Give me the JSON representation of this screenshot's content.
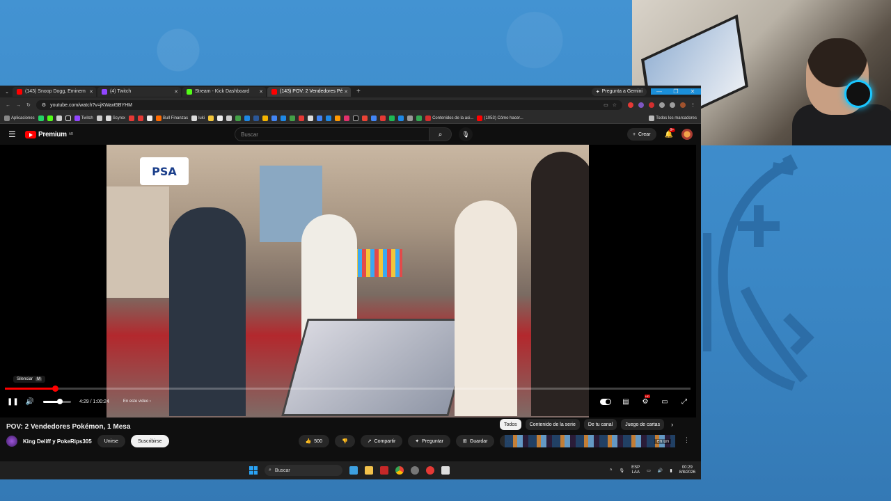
{
  "browser": {
    "tabs": [
      {
        "label": "(143) Snoop Dogg, Eminem",
        "favicon_color": "#ff0000",
        "active": false
      },
      {
        "label": "(4) Twitch",
        "favicon_color": "#9146ff",
        "active": false
      },
      {
        "label": "Stream - Kick Dashboard",
        "favicon_color": "#53fc18",
        "active": false
      },
      {
        "label": "(143) POV: 2 Vendedores Pé",
        "favicon_color": "#ff0000",
        "active": true
      }
    ],
    "new_tab_label": "+",
    "gemini_label": "Pregunta a Gemini",
    "url": "youtube.com/watch?v=jKWaxt5BYHM",
    "bookmarks": [
      {
        "label": "Aplicaciones",
        "color": "#888888"
      },
      {
        "label": "",
        "color": "#25d366"
      },
      {
        "label": "",
        "color": "#53fc18"
      },
      {
        "label": "Twitch",
        "color": "#9146ff"
      },
      {
        "label": "Scyrox",
        "color": "#d0d0d0"
      },
      {
        "label": "Bull Finanzas",
        "color": "#ff6a00"
      },
      {
        "label": "luki",
        "color": "#d0d0d0"
      },
      {
        "label": "",
        "color": "#e33b2e"
      },
      {
        "label": "",
        "color": "#1e88e5"
      },
      {
        "label": "",
        "color": "#43a047"
      },
      {
        "label": "Contenidos de la asi...",
        "color": "#d32f2f"
      },
      {
        "label": "(1053) Cómo hacer...",
        "color": "#ff0000"
      }
    ],
    "bookmarks_right": "Todos los marcadores"
  },
  "youtube": {
    "logo_text": "Premium",
    "logo_region": "AR",
    "search_placeholder": "Buscar",
    "create_label": "Crear",
    "notif_badge": "9+",
    "tooltip_label": "Silenciar",
    "tooltip_key": "M",
    "progress_fraction": 0.0736,
    "volume_fraction": 0.6,
    "time_current": "4:29",
    "time_total": "1:00:24",
    "time_sep": "/",
    "chapter_label": "En este video",
    "video_title": "POV: 2 Vendedores Pokémon, 1 Mesa",
    "channel_name": "King Deliff y PokeRips305",
    "join_label": "Unirse",
    "subscribe_label": "Suscribirse",
    "likes": "500",
    "share_label": "Compartir",
    "ask_label": "Preguntar",
    "save_label": "Guardar",
    "chips": [
      "Todos",
      "Contenido de la serie",
      "De tu canal",
      "Juego de cartas"
    ],
    "game_overlay_text": "en un",
    "sign_text": "PSA"
  },
  "taskbar": {
    "search_label": "Buscar",
    "lang_top": "ESP",
    "lang_bottom": "LAA",
    "time": "00:29",
    "date": "8/8/2026"
  }
}
